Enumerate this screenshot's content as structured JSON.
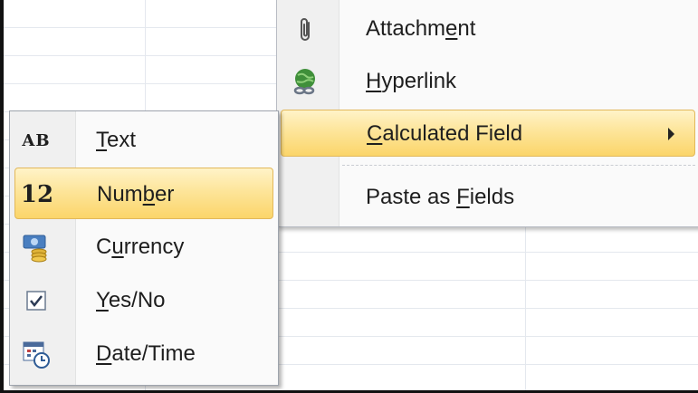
{
  "menu": {
    "items": [
      {
        "pre": "Attachm",
        "key": "e",
        "post": "nt",
        "icon": "paperclip-icon"
      },
      {
        "pre": "",
        "key": "H",
        "post": "yperlink",
        "icon": "hyperlink-globe-icon"
      },
      {
        "pre": "",
        "key": "C",
        "post": "alculated Field",
        "icon": "",
        "highlighted": true,
        "has_submenu": true
      },
      {
        "pre": "Paste as ",
        "key": "F",
        "post": "ields",
        "icon": ""
      }
    ]
  },
  "submenu": {
    "items": [
      {
        "pre": "",
        "key": "T",
        "post": "ext",
        "icon": "text-ab-icon",
        "glyph": "AB"
      },
      {
        "pre": "Num",
        "key": "b",
        "post": "er",
        "icon": "number-12-icon",
        "glyph": "12",
        "highlighted": true
      },
      {
        "pre": "C",
        "key": "u",
        "post": "rrency",
        "icon": "currency-icon"
      },
      {
        "pre": "",
        "key": "Y",
        "post": "es/No",
        "icon": "checkbox-icon"
      },
      {
        "pre": "",
        "key": "D",
        "post": "ate/Time",
        "icon": "calendar-clock-icon"
      }
    ]
  },
  "colors": {
    "highlight_top": "#fff3c8",
    "highlight_bottom": "#fbd56a",
    "highlight_border": "#e2b85a",
    "menu_bg": "#fafafa",
    "gutter_bg": "#f0f0f0"
  }
}
